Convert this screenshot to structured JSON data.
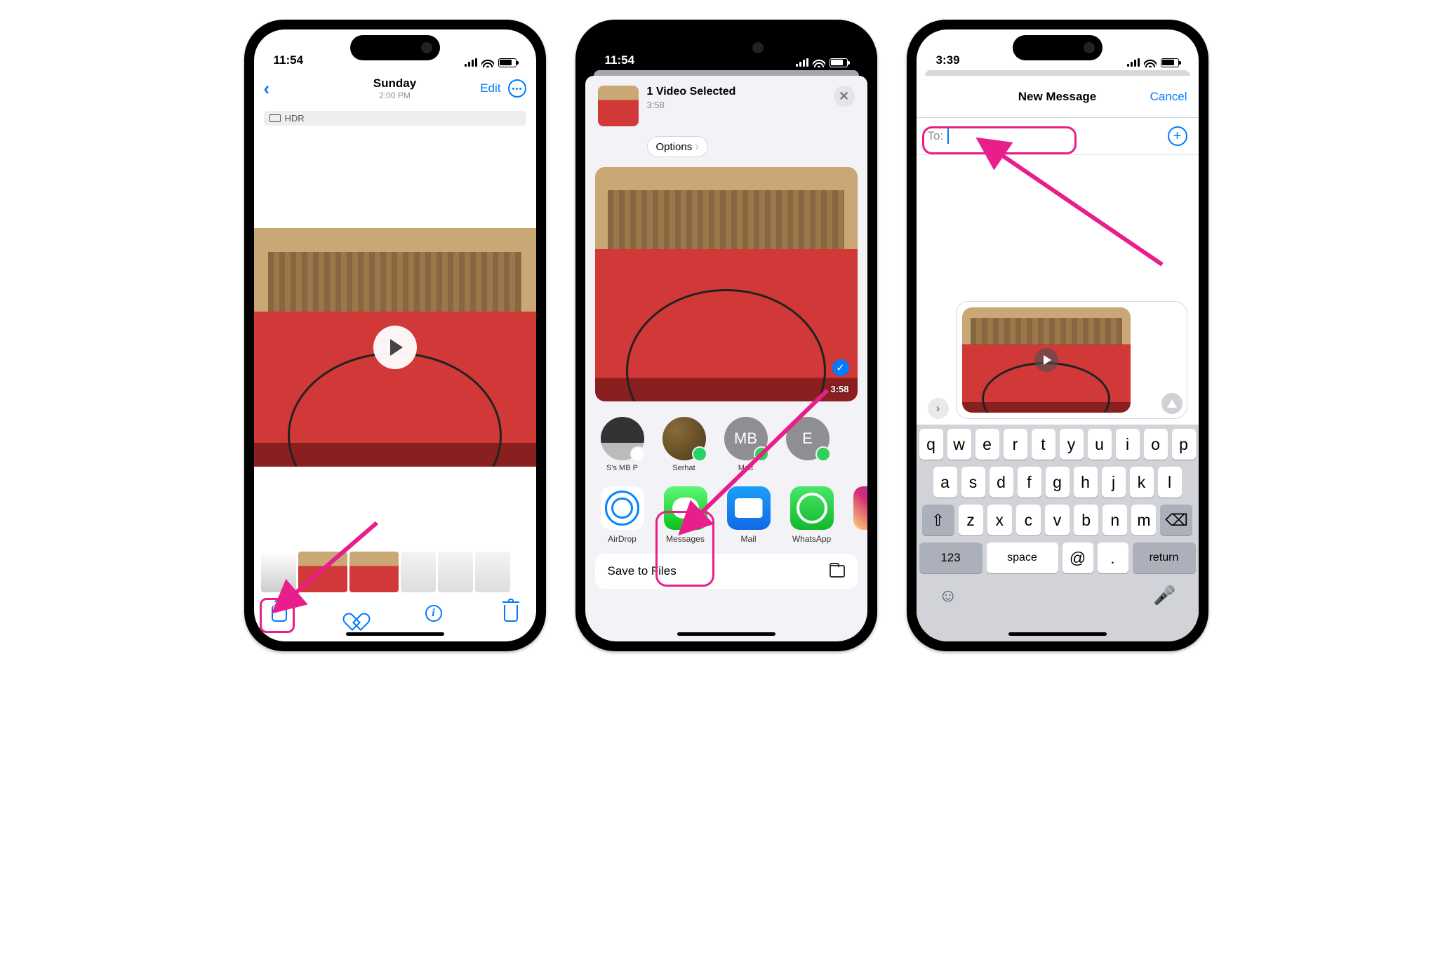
{
  "screen1": {
    "status": {
      "time": "11:54"
    },
    "nav": {
      "day": "Sunday",
      "time": "2:00 PM",
      "edit": "Edit"
    },
    "badge": "HDR",
    "toolbar": {}
  },
  "screen2": {
    "status": {
      "time": "11:54"
    },
    "header": {
      "title": "1 Video Selected",
      "duration": "3:58",
      "options": "Options"
    },
    "preview": {
      "duration": "3:58"
    },
    "contacts": [
      {
        "name": "S's MB P",
        "avatarType": "laptop",
        "badge": "airdrop"
      },
      {
        "name": "Serhat",
        "avatarType": "photo",
        "badge": "whatsapp"
      },
      {
        "name": "Matt",
        "avatarType": "initials",
        "initials": "MB",
        "badge": "messages"
      },
      {
        "name": "",
        "avatarType": "initials",
        "initials": "E",
        "badge": "messages"
      }
    ],
    "apps": [
      {
        "name": "AirDrop",
        "icon": "airdrop"
      },
      {
        "name": "Messages",
        "icon": "messages"
      },
      {
        "name": "Mail",
        "icon": "mail"
      },
      {
        "name": "WhatsApp",
        "icon": "whatsapp"
      },
      {
        "name": "In",
        "icon": "instagram"
      }
    ],
    "actions": {
      "saveToFiles": "Save to Files"
    }
  },
  "screen3": {
    "status": {
      "time": "3:39"
    },
    "nav": {
      "title": "New Message",
      "cancel": "Cancel"
    },
    "to": {
      "label": "To:",
      "value": ""
    },
    "keyboard": {
      "row1": [
        "q",
        "w",
        "e",
        "r",
        "t",
        "y",
        "u",
        "i",
        "o",
        "p"
      ],
      "row2": [
        "a",
        "s",
        "d",
        "f",
        "g",
        "h",
        "j",
        "k",
        "l"
      ],
      "row3": [
        "z",
        "x",
        "c",
        "v",
        "b",
        "n",
        "m"
      ],
      "num": "123",
      "space": "space",
      "at": "@",
      "dot": ".",
      "ret": "return"
    }
  }
}
